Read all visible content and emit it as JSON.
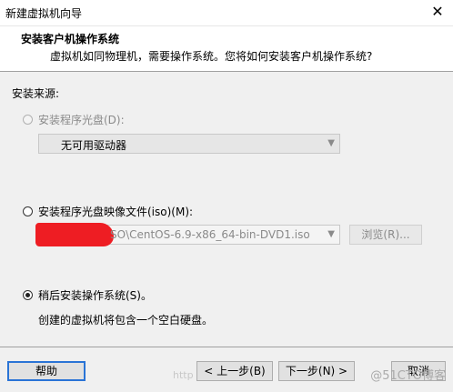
{
  "window": {
    "title": "新建虚拟机向导",
    "close_glyph": "✕"
  },
  "header": {
    "title": "安装客户机操作系统",
    "subtitle": "虚拟机如同物理机，需要操作系统。您将如何安装客户机操作系统?"
  },
  "install_source": {
    "label": "安装来源:",
    "disc": {
      "label": "安装程序光盘(D):",
      "selected": false,
      "enabled": false,
      "drive_value": "无可用驱动器"
    },
    "iso": {
      "label": "安装程序光盘映像文件(iso)(M):",
      "selected": false,
      "path_value": "SO\\CentOS-6.9-x86_64-bin-DVD1.iso",
      "browse_label": "浏览(R)..."
    },
    "later": {
      "label": "稍后安装操作系统(S)。",
      "selected": true,
      "description": "创建的虚拟机将包含一个空白硬盘。"
    }
  },
  "footer": {
    "help_label": "帮助",
    "back_label": "< 上一步(B)",
    "next_label": "下一步(N) >",
    "cancel_label": "取消",
    "watermark_url": "http",
    "watermark_brand": "@51CTO博客"
  },
  "icons": {
    "dropdown": "chevron-down-icon"
  }
}
